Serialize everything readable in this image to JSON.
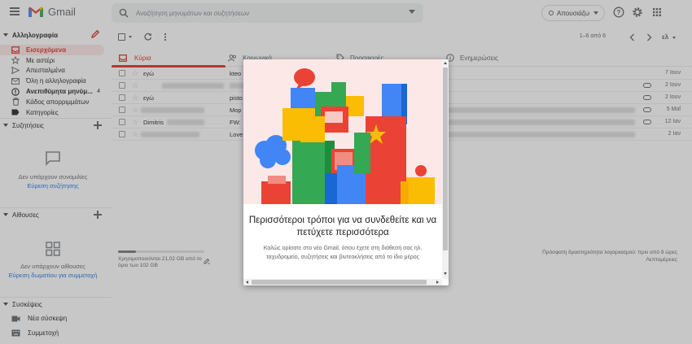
{
  "header": {
    "brand": "Gmail",
    "search_placeholder": "Αναζήτηση μηνυμάτων και συζητήσεων",
    "status": "Απουσιάζω",
    "account_label": "ελ"
  },
  "sidebar": {
    "mail_section": "Αλληλογραφία",
    "items": [
      {
        "label": "Εισερχόμενα",
        "icon": "inbox-icon",
        "count": ""
      },
      {
        "label": "Με αστέρι",
        "icon": "star-icon",
        "count": ""
      },
      {
        "label": "Απεσταλμένα",
        "icon": "send-icon",
        "count": ""
      },
      {
        "label": "Όλη η αλληλογραφία",
        "icon": "mail-icon",
        "count": ""
      },
      {
        "label": "Ανεπιθύμητα μηνύμ...",
        "icon": "spam-icon",
        "count": "4"
      },
      {
        "label": "Κάδος απορριμμάτων",
        "icon": "trash-icon",
        "count": ""
      },
      {
        "label": "Κατηγορίες",
        "icon": "label-icon",
        "count": ""
      }
    ],
    "chat_section": "Συζητήσεις",
    "chat_empty": "Δεν υπάρχουν συνομιλίες",
    "chat_link": "Εύρεση συζήτησης",
    "rooms_section": "Αίθουσες",
    "rooms_empty": "Δεν υπάρχουν αίθουσες",
    "rooms_link": "Εύρεση δωματίου για συμμετοχή",
    "meet_section": "Συσκέψεις",
    "meet_new": "Νέα σύσκεψη",
    "meet_join": "Συμμετοχή"
  },
  "toolbar": {
    "pager": "1–6 από 6"
  },
  "tabs": [
    {
      "label": "Κύρια",
      "icon": "inbox-tab-icon"
    },
    {
      "label": "Κοινωνικά",
      "icon": "people-icon"
    },
    {
      "label": "Προσφορές",
      "icon": "tag-icon"
    },
    {
      "label": "Ενημερώσεις",
      "icon": "info-icon"
    }
  ],
  "emails": [
    {
      "sender": "εγώ",
      "subject": "kteo",
      "date": "7 Ιουν",
      "attachment": false
    },
    {
      "sender": "",
      "subject": "",
      "date": "2 Ιουν",
      "attachment": true
    },
    {
      "sender": "εγώ",
      "subject": "pisto",
      "date": "2 Ιουν",
      "attachment": true
    },
    {
      "sender": "",
      "subject": "Mop",
      "date": "5 Μαΐ",
      "attachment": true
    },
    {
      "sender": "Dimitris",
      "subject": "FW:",
      "date": "12 Ιαν",
      "attachment": true
    },
    {
      "sender": "",
      "subject": "Love",
      "date": "2 Ιαν",
      "attachment": false
    }
  ],
  "storage": {
    "used_fraction": 0.206,
    "text": "Χρησιμοποιούνται 21,02 GB από το όριο των 102 GB"
  },
  "activity": {
    "line1": "Πρόσφατη δραστηριότητα λογαριασμού: πριν από 9 ώρες",
    "line2": "Λεπτομέρειες"
  },
  "dialog": {
    "title": "Περισσότεροι τρόποι για να συνδεθείτε και να πετύχετε περισσότερα",
    "body": "Καλώς ορίσατε στο νέο Gmail, όπου έχετε στη διάθεσή σας ηλ. ταχυδρομείο, συζητήσεις και βιντεοκλήσεις από το ίδιο μέρος"
  },
  "colors": {
    "accent_red": "#d93025",
    "active_bg": "#fce8e6",
    "link_blue": "#1a73e8"
  }
}
